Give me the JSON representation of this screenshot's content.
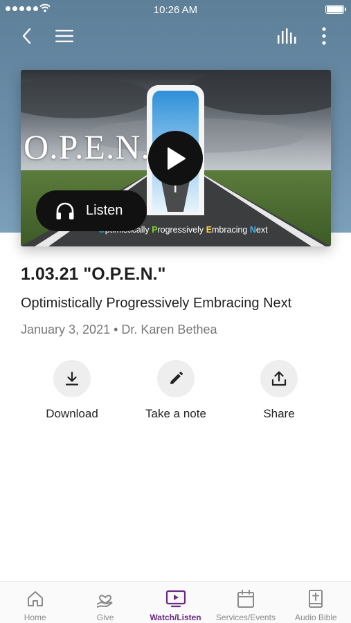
{
  "status_bar": {
    "time": "10:26 AM"
  },
  "media": {
    "art_title": "O.P.E.N.",
    "art_subtitle": [
      {
        "initial": "O",
        "rest": "ptimistically "
      },
      {
        "initial": "P",
        "rest": "rogressively "
      },
      {
        "initial": "E",
        "rest": "mbracing "
      },
      {
        "initial": "N",
        "rest": "ext"
      }
    ],
    "listen_label": "Listen"
  },
  "sermon": {
    "title": "1.03.21 \"O.P.E.N.\"",
    "subtitle": "Optimistically Progressively Embracing Next",
    "meta": "January 3, 2021 • Dr. Karen Bethea"
  },
  "actions": [
    {
      "label": "Download",
      "icon": "download-icon"
    },
    {
      "label": "Take a note",
      "icon": "pencil-icon"
    },
    {
      "label": "Share",
      "icon": "share-icon"
    }
  ],
  "tabs": [
    {
      "label": "Home",
      "icon": "home-icon",
      "active": false
    },
    {
      "label": "Give",
      "icon": "give-icon",
      "active": false
    },
    {
      "label": "Watch/Listen",
      "icon": "tv-play-icon",
      "active": true
    },
    {
      "label": "Services/Events",
      "icon": "calendar-icon",
      "active": false
    },
    {
      "label": "Audio Bible",
      "icon": "bible-icon",
      "active": false
    }
  ],
  "colors": {
    "header": "#6c8ea8",
    "active_tab": "#6b2a83",
    "inactive_tab": "#8a8a8a",
    "art_initials": [
      "#1ea7c8",
      "#7ed321",
      "#ffd23f",
      "#3fb6f0"
    ]
  }
}
